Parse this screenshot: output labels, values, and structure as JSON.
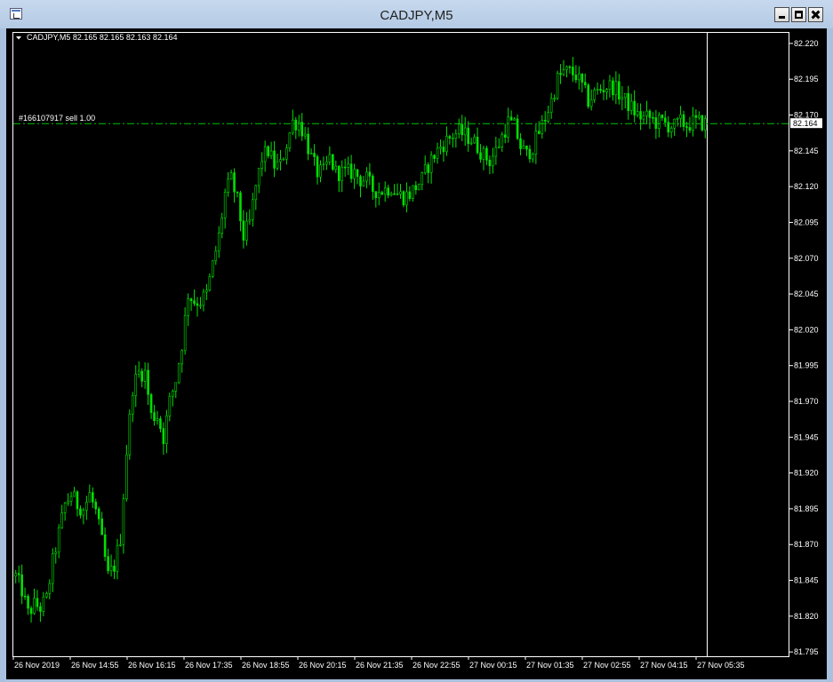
{
  "window": {
    "title": "CADJPY,M5",
    "buttons": {
      "minimize": "minimize",
      "maximize": "maximize",
      "close": "close"
    }
  },
  "chart": {
    "info": "CADJPY,M5  82.165 82.165 82.163 82.164",
    "order_label": "#166107917 sell 1.00",
    "order_price": 82.164,
    "current_price_label": "82.164"
  },
  "chart_data": {
    "type": "candlestick",
    "symbol": "CADJPY",
    "timeframe": "M5",
    "yticks": [
      "82.220",
      "82.195",
      "82.170",
      "82.145",
      "82.120",
      "82.095",
      "82.070",
      "82.045",
      "82.020",
      "81.995",
      "81.970",
      "81.945",
      "81.920",
      "81.895",
      "81.870",
      "81.845",
      "81.820",
      "81.795"
    ],
    "xticks": [
      "26 Nov 2019",
      "26 Nov 14:55",
      "26 Nov 16:15",
      "26 Nov 17:35",
      "26 Nov 18:55",
      "26 Nov 20:15",
      "26 Nov 21:35",
      "26 Nov 22:55",
      "27 Nov 00:15",
      "27 Nov 01:35",
      "27 Nov 02:55",
      "27 Nov 04:15",
      "27 Nov 05:35"
    ],
    "ylim": [
      81.792,
      82.228
    ],
    "close_path": [
      [
        0,
        81.848
      ],
      [
        2,
        81.838
      ],
      [
        4,
        81.822
      ],
      [
        6,
        81.828
      ],
      [
        8,
        81.826
      ],
      [
        10,
        81.832
      ],
      [
        12,
        81.858
      ],
      [
        14,
        81.878
      ],
      [
        16,
        81.898
      ],
      [
        18,
        81.905
      ],
      [
        20,
        81.898
      ],
      [
        22,
        81.895
      ],
      [
        24,
        81.905
      ],
      [
        26,
        81.893
      ],
      [
        28,
        81.872
      ],
      [
        30,
        81.848
      ],
      [
        32,
        81.855
      ],
      [
        34,
        81.875
      ],
      [
        36,
        81.935
      ],
      [
        38,
        81.98
      ],
      [
        40,
        81.99
      ],
      [
        42,
        81.99
      ],
      [
        44,
        81.96
      ],
      [
        46,
        81.96
      ],
      [
        48,
        81.945
      ],
      [
        50,
        81.97
      ],
      [
        52,
        81.985
      ],
      [
        54,
        82.01
      ],
      [
        56,
        82.045
      ],
      [
        58,
        82.04
      ],
      [
        60,
        82.04
      ],
      [
        62,
        82.045
      ],
      [
        64,
        82.065
      ],
      [
        66,
        82.085
      ],
      [
        68,
        82.115
      ],
      [
        70,
        82.125
      ],
      [
        72,
        82.11
      ],
      [
        74,
        82.085
      ],
      [
        76,
        82.095
      ],
      [
        78,
        82.12
      ],
      [
        80,
        82.14
      ],
      [
        82,
        82.145
      ],
      [
        84,
        82.135
      ],
      [
        86,
        82.135
      ],
      [
        88,
        82.15
      ],
      [
        90,
        82.165
      ],
      [
        92,
        82.165
      ],
      [
        94,
        82.155
      ],
      [
        96,
        82.14
      ],
      [
        98,
        82.13
      ],
      [
        100,
        82.13
      ],
      [
        102,
        82.14
      ],
      [
        104,
        82.13
      ],
      [
        106,
        82.13
      ],
      [
        108,
        82.13
      ],
      [
        110,
        82.13
      ],
      [
        112,
        82.125
      ],
      [
        114,
        82.125
      ],
      [
        116,
        82.118
      ],
      [
        118,
        82.117
      ],
      [
        120,
        82.118
      ],
      [
        122,
        82.12
      ],
      [
        124,
        82.115
      ],
      [
        126,
        82.113
      ],
      [
        128,
        82.115
      ],
      [
        130,
        82.12
      ],
      [
        132,
        82.125
      ],
      [
        134,
        82.135
      ],
      [
        136,
        82.142
      ],
      [
        138,
        82.148
      ],
      [
        140,
        82.152
      ],
      [
        142,
        82.156
      ],
      [
        144,
        82.158
      ],
      [
        146,
        82.156
      ],
      [
        148,
        82.153
      ],
      [
        150,
        82.148
      ],
      [
        152,
        82.142
      ],
      [
        154,
        82.138
      ],
      [
        156,
        82.145
      ],
      [
        158,
        82.155
      ],
      [
        160,
        82.165
      ],
      [
        162,
        82.162
      ],
      [
        164,
        82.148
      ],
      [
        166,
        82.142
      ],
      [
        168,
        82.148
      ],
      [
        170,
        82.158
      ],
      [
        172,
        82.168
      ],
      [
        174,
        82.18
      ],
      [
        176,
        82.195
      ],
      [
        178,
        82.2
      ],
      [
        180,
        82.2
      ],
      [
        182,
        82.198
      ],
      [
        184,
        82.19
      ],
      [
        186,
        82.18
      ],
      [
        188,
        82.185
      ],
      [
        190,
        82.188
      ],
      [
        192,
        82.19
      ],
      [
        194,
        82.19
      ],
      [
        196,
        82.185
      ],
      [
        198,
        82.18
      ],
      [
        200,
        82.175
      ],
      [
        202,
        82.17
      ],
      [
        204,
        82.168
      ],
      [
        206,
        82.168
      ],
      [
        208,
        82.165
      ],
      [
        210,
        82.165
      ],
      [
        212,
        82.163
      ],
      [
        214,
        82.162
      ],
      [
        216,
        82.165
      ],
      [
        218,
        82.163
      ],
      [
        220,
        82.165
      ],
      [
        222,
        82.165
      ],
      [
        224,
        82.164
      ]
    ],
    "bar_count": 225,
    "grid": false,
    "background": "#000000",
    "candle_color": "#00e000",
    "axis_color": "#ffffff"
  }
}
